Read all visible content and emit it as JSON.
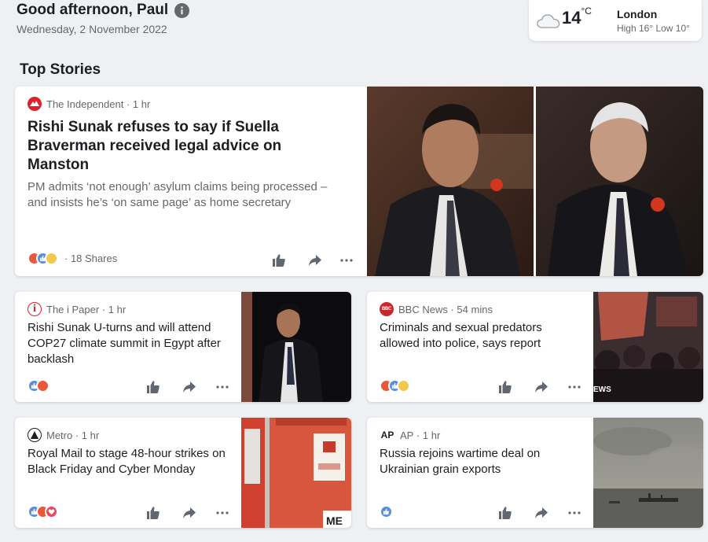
{
  "header": {
    "greeting": "Good afternoon, Paul",
    "date": "Wednesday, 2 November 2022"
  },
  "weather": {
    "temperature": "14",
    "unit": "°C",
    "city": "London",
    "high_low": "High 16° Low 10°",
    "icon": "cloud-icon"
  },
  "section_title": "Top Stories",
  "stories": [
    {
      "source": "The Independent",
      "time": "· 1 hr",
      "headline": "Rishi Sunak refuses to say if Suella Braverman received legal advice on Manston",
      "summary": "PM admits ‘not enough’ asylum claims being processed – and insists he’s ‘on same page’ as home secretary",
      "shares": "· 18 Shares",
      "logo_color": "#e0202c"
    },
    {
      "source": "The i Paper",
      "time": "· 1 hr",
      "headline": "Rishi Sunak U-turns and will attend COP27 climate summit in Egypt after backlash",
      "logo_color": "#e0202c"
    },
    {
      "source": "BBC News",
      "time": "· 54 mins",
      "headline": "Criminals and sexual predators allowed into police, says report",
      "logo_color": "#c8282d"
    },
    {
      "source": "Metro",
      "time": "· 1 hr",
      "headline": "Royal Mail to stage 48-hour strikes on Black Friday and Cyber Monday",
      "logo_color": "#1c1e21"
    },
    {
      "source": "AP",
      "time": "· 1 hr",
      "headline": "Russia rejoins wartime deal on Ukrainian grain exports",
      "logo_color": "#1c1e21"
    }
  ],
  "image_text": {
    "bbc_fragment": "EWS",
    "metro_fragment": "ME"
  },
  "colors": {
    "angry": "#e8593a",
    "like": "#5a8ed8",
    "love": "#f0445c",
    "background": "#eef0f3"
  }
}
